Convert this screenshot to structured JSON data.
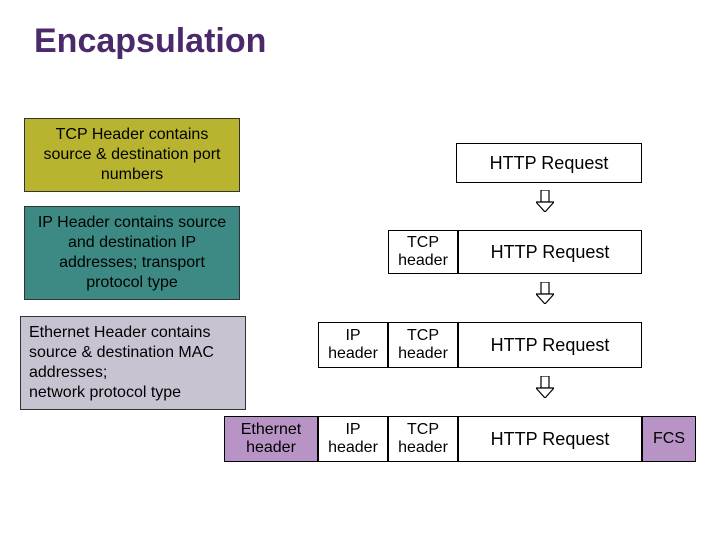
{
  "title": "Encapsulation",
  "labels": {
    "tcp": "TCP Header contains source & destination port numbers",
    "ip": "IP Header contains source and destination IP addresses; transport protocol type",
    "eth": "Ethernet Header contains source & destination MAC addresses;\nnetwork protocol type"
  },
  "blocks": {
    "http": "HTTP Request",
    "tcp": "TCP header",
    "ip": "IP header",
    "eth": "Ethernet header",
    "fcs": "FCS"
  },
  "colors": {
    "title": "#4b2a6b",
    "tcp_label_bg": "#b8b430",
    "ip_label_bg": "#3d8a84",
    "eth_label_bg": "#c8c3d1",
    "eth_block_bg": "#b893c5"
  }
}
